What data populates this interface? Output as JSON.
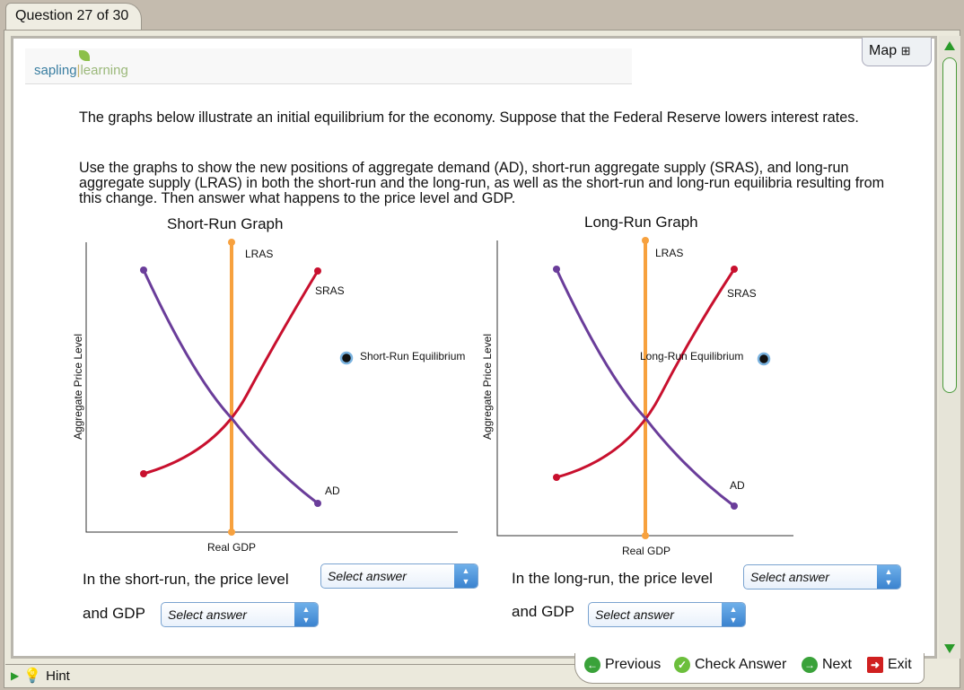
{
  "header": {
    "question_tab": "Question 27 of 30",
    "logo": "sapling learning",
    "logo_left": "sapling",
    "logo_right": "learning",
    "map_label": "Map"
  },
  "question": {
    "p1": "The graphs below illustrate an initial equilibrium for the economy. Suppose that the Federal Reserve lowers interest rates.",
    "p2": "Use the graphs to show the new positions of aggregate demand (AD), short-run aggregate supply (SRAS), and long-run aggregate supply (LRAS) in both the short-run and the long-run, as well as the short-run and long-run equilibria resulting from this change. Then answer what happens to the price level and GDP."
  },
  "graphs": {
    "short": {
      "title": "Short-Run Graph",
      "ylabel": "Aggregate Price Level",
      "xlabel": "Real GDP",
      "lras": "LRAS",
      "sras": "SRAS",
      "ad": "AD",
      "equilibrium": "Short-Run Equilibrium"
    },
    "long": {
      "title": "Long-Run Graph",
      "ylabel": "Aggregate Price Level",
      "xlabel": "Real GDP",
      "lras": "LRAS",
      "sras": "SRAS",
      "ad": "AD",
      "equilibrium": "Long-Run Equilibrium"
    },
    "colors": {
      "lras": "#f7a13e",
      "sras": "#c8102e",
      "ad": "#6a3d9a"
    }
  },
  "answers": {
    "short_price_label": "In the short-run, the price level",
    "short_gdp_label": "and GDP",
    "long_price_label": "In the long-run, the price level",
    "long_gdp_label": "and GDP",
    "select_placeholder": "Select answer"
  },
  "footer": {
    "hint": "Hint",
    "previous": "Previous",
    "check": "Check Answer",
    "next": "Next",
    "exit": "Exit"
  }
}
